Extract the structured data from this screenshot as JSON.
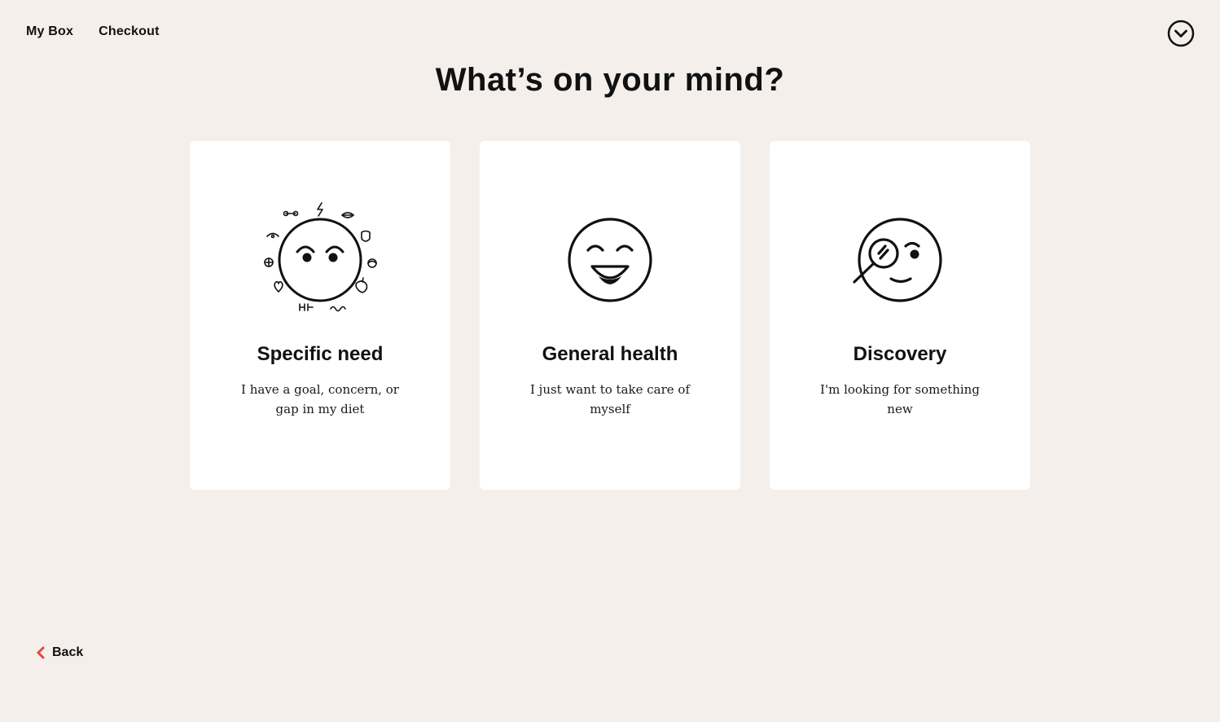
{
  "nav": {
    "links": [
      {
        "label": "My Box"
      },
      {
        "label": "Checkout"
      }
    ]
  },
  "title": "What’s on your mind?",
  "cards": [
    {
      "title": "Specific need",
      "description": "I have a goal, concern, or gap in my diet",
      "icon": "specific-need-face-icon"
    },
    {
      "title": "General health",
      "description": "I just want to take care of myself",
      "icon": "smiling-face-icon"
    },
    {
      "title": "Discovery",
      "description": "I'm looking for something new",
      "icon": "magnifier-face-icon"
    }
  ],
  "back": {
    "label": "Back",
    "icon": "chevron-left-icon"
  },
  "menu": {
    "icon": "chevron-down-circle-icon"
  },
  "colors": {
    "background": "#f4efeb",
    "card": "#ffffff",
    "accent": "#e8453c",
    "text": "#111111"
  }
}
